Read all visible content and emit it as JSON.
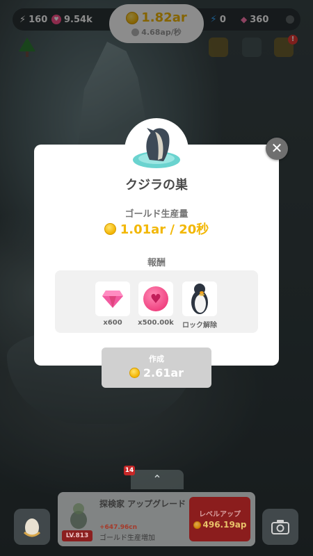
{
  "hud": {
    "resource1": "160",
    "resource2": "9.54k",
    "gold_total": "1.82ar",
    "gold_rate": "4.68ap/秒",
    "energy": "0",
    "gems": "360"
  },
  "alert_badge": "!",
  "modal": {
    "title": "クジラの巣",
    "production_label": "ゴールド生産量",
    "production_value": "1.01ar / 20秒",
    "rewards_label": "報酬",
    "rewards": [
      {
        "icon": "gem-icon",
        "caption": "x600"
      },
      {
        "icon": "heart-token-icon",
        "caption": "x500.00k"
      },
      {
        "icon": "penguin-icon",
        "caption": "ロック解除"
      }
    ],
    "create_label": "作成",
    "create_cost": "2.61ar",
    "close_glyph": "✕"
  },
  "bottom": {
    "notification_count": "14",
    "upgrade_title": "探検家 アップグレード",
    "upgrade_delta": "+647.96cn",
    "upgrade_desc": "ゴールド生産増加",
    "level": "LV.813",
    "levelup_label": "レベルアップ",
    "levelup_cost": "496.19ap"
  },
  "colors": {
    "gold": "#f2b705",
    "modal_bg": "#ffffff",
    "button_disabled": "#d0d0d0",
    "levelup_red": "#8b1d1d"
  }
}
